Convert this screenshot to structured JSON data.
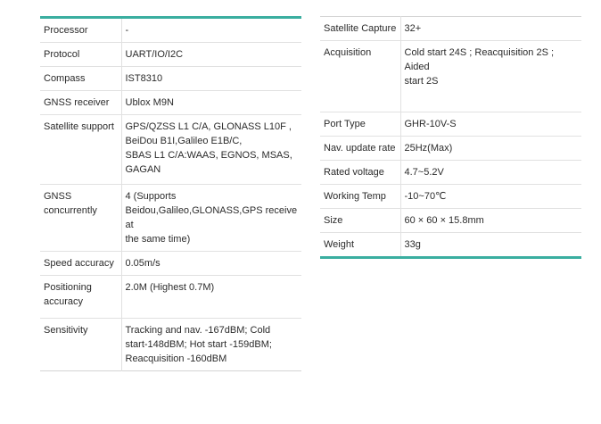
{
  "left_table": {
    "rows": [
      {
        "key": "Processor",
        "value": "-"
      },
      {
        "key": "Protocol",
        "value": "UART/IO/I2C"
      },
      {
        "key": "Compass",
        "value": "IST8310"
      },
      {
        "key": "GNSS receiver",
        "value": "Ublox M9N"
      },
      {
        "key": "Satellite support",
        "value": "GPS/QZSS L1 C/A,  GLONASS L10F ,\nBeiDou B1I,Galileo E1B/C,\nSBAS L1 C/A:WAAS, EGNOS, MSAS,\nGAGAN"
      },
      {
        "key": "GNSS\nconcurrently",
        "value": "4 (Supports\nBeidou,Galileo,GLONASS,GPS receive at\nthe same time)"
      },
      {
        "key": "Speed accuracy",
        "value": "0.05m/s"
      },
      {
        "key": "Positioning\naccuracy",
        "value": "2.0M (Highest 0.7M)"
      },
      {
        "key": "Sensitivity",
        "value": "Tracking and nav. -167dBM; Cold\nstart-148dBM; Hot start -159dBM;\nReacquisition -160dBM"
      }
    ]
  },
  "right_table": {
    "rows": [
      {
        "key": "Satellite Capture",
        "value": "32+"
      },
      {
        "key": "Acquisition",
        "value": "Cold start 24S ; Reacquisition 2S ; Aided\nstart 2S"
      },
      {
        "key": "Port Type",
        "value": "GHR-10V-S"
      },
      {
        "key": "Nav. update rate",
        "value": "25Hz(Max)"
      },
      {
        "key": "Rated voltage",
        "value": "4.7~5.2V"
      },
      {
        "key": "Working Temp",
        "value": "-10~70℃"
      },
      {
        "key": "Size",
        "value": "60 × 60 × 15.8mm"
      },
      {
        "key": "Weight",
        "value": "33g"
      }
    ]
  },
  "colors": {
    "accent": "#3aaea0",
    "rule": "#e1e1e1",
    "text": "#2b2b2b"
  }
}
